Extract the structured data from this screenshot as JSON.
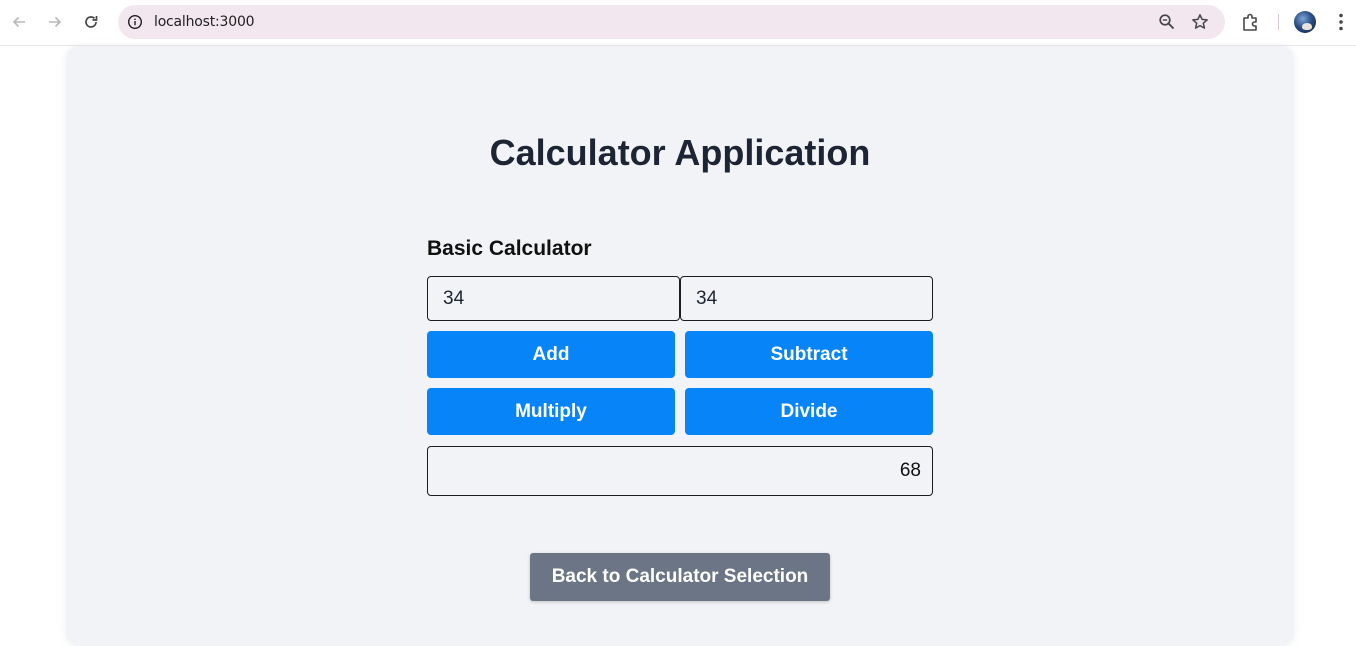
{
  "browser": {
    "url": "localhost:3000",
    "icons": {
      "back": "back-arrow-icon",
      "forward": "forward-arrow-icon",
      "reload": "reload-icon",
      "site_info": "info-icon",
      "zoom": "zoom-icon",
      "bookmark": "star-icon",
      "extensions": "puzzle-icon",
      "profile": "avatar",
      "menu": "kebab-menu-icon"
    }
  },
  "app": {
    "title": "Calculator Application",
    "calculator": {
      "heading": "Basic Calculator",
      "operand_a": "34",
      "operand_b": "34",
      "buttons": {
        "add": "Add",
        "subtract": "Subtract",
        "multiply": "Multiply",
        "divide": "Divide"
      },
      "result": "68"
    },
    "back_button": "Back to Calculator Selection"
  },
  "colors": {
    "primary_button": "#0784f7",
    "secondary_button": "#6b7585",
    "page_background": "#f2f3f6",
    "title_text": "#1d2433",
    "omnibox": "#f2e7ef"
  }
}
